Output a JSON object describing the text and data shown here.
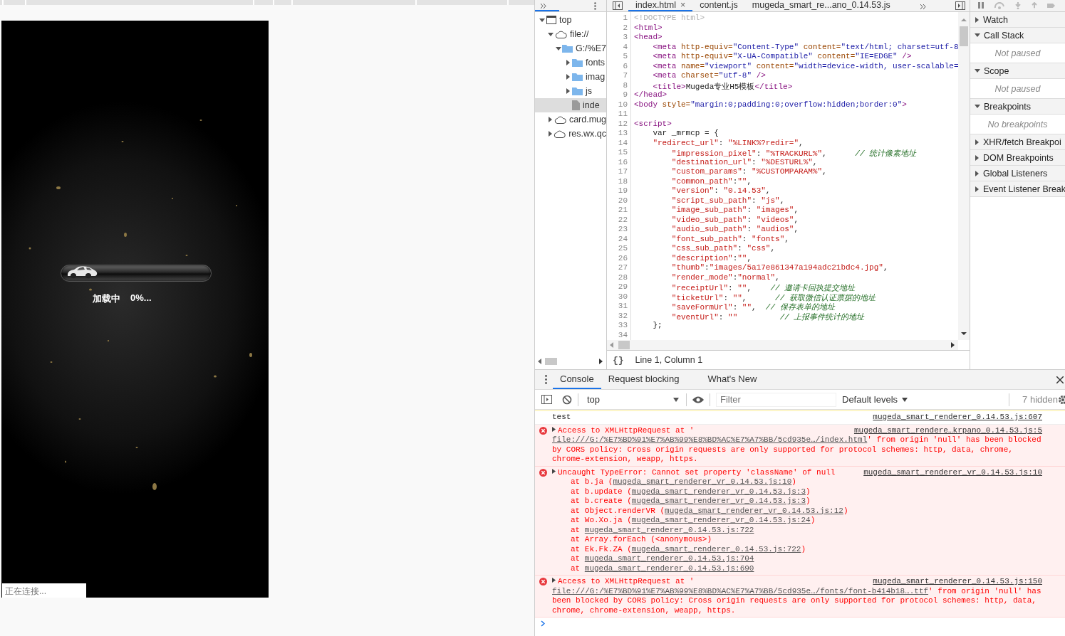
{
  "preview": {
    "progress": {
      "level": 0
    },
    "loading_label": "加载中",
    "loading_percent": "0%...",
    "status_text": "正在连接..."
  },
  "navigator": {
    "tree": [
      {
        "kind": "frame",
        "label": "top",
        "expanded": true,
        "selected": false,
        "children": [
          {
            "kind": "domain",
            "label": "file://",
            "expanded": true,
            "selected": false,
            "children": [
              {
                "kind": "folder",
                "label": "G:/%E7",
                "expanded": true,
                "selected": false,
                "children": [
                  {
                    "kind": "folder",
                    "label": "fonts",
                    "expanded": false,
                    "selected": false
                  },
                  {
                    "kind": "folder",
                    "label": "imag",
                    "expanded": false,
                    "selected": false
                  },
                  {
                    "kind": "folder",
                    "label": "js",
                    "expanded": false,
                    "selected": false
                  },
                  {
                    "kind": "file",
                    "label": "inde",
                    "selected": true
                  }
                ]
              }
            ]
          },
          {
            "kind": "domain",
            "label": "card.mug",
            "expanded": false,
            "selected": false
          },
          {
            "kind": "domain",
            "label": "res.wx.qc",
            "expanded": false,
            "selected": false
          }
        ]
      }
    ]
  },
  "editor": {
    "tabs": [
      {
        "label": "index.html",
        "selected": true,
        "close": "×"
      },
      {
        "label": "content.js",
        "selected": false
      },
      {
        "label": "mugeda_smart_re...ano_0.14.53.js",
        "selected": false
      }
    ],
    "lines": [
      {
        "number": "1",
        "tokens": [
          {
            "kind": "doctype",
            "text": "<!DOCTYPE html>"
          }
        ]
      },
      {
        "number": "2",
        "tokens": [
          {
            "kind": "tag",
            "text": "<html>"
          }
        ]
      },
      {
        "number": "3",
        "tokens": [
          {
            "kind": "tag",
            "text": "<head>"
          }
        ]
      },
      {
        "number": "4",
        "tokens": [
          {
            "kind": "tag",
            "text": "    <meta"
          },
          {
            "kind": "attr",
            "text": " http-equiv="
          },
          {
            "kind": "value",
            "text": "\"Content-Type\""
          },
          {
            "kind": "attr",
            "text": " content="
          },
          {
            "kind": "value",
            "text": "\"text/html; charset=utf-8"
          }
        ]
      },
      {
        "number": "5",
        "tokens": [
          {
            "kind": "tag",
            "text": "    <meta"
          },
          {
            "kind": "attr",
            "text": " http-equiv="
          },
          {
            "kind": "value",
            "text": "\"X-UA-Compatible\""
          },
          {
            "kind": "attr",
            "text": " content="
          },
          {
            "kind": "value",
            "text": "\"IE=EDGE\""
          },
          {
            "kind": "tag",
            "text": " />"
          }
        ]
      },
      {
        "number": "6",
        "tokens": [
          {
            "kind": "tag",
            "text": "    <meta"
          },
          {
            "kind": "attr",
            "text": " name="
          },
          {
            "kind": "value",
            "text": "\"viewport\""
          },
          {
            "kind": "attr",
            "text": " content="
          },
          {
            "kind": "value",
            "text": "\"width=device-width, user-scalable="
          }
        ]
      },
      {
        "number": "7",
        "tokens": [
          {
            "kind": "tag",
            "text": "    <meta"
          },
          {
            "kind": "attr",
            "text": " charset="
          },
          {
            "kind": "value",
            "text": "\"utf-8\""
          },
          {
            "kind": "tag",
            "text": " />"
          }
        ]
      },
      {
        "number": "8",
        "tokens": [
          {
            "kind": "tag",
            "text": "    <title>"
          },
          {
            "kind": "plain",
            "text": "Mugeda专业H5模板"
          },
          {
            "kind": "tag",
            "text": "</title>"
          }
        ]
      },
      {
        "number": "9",
        "tokens": [
          {
            "kind": "tag",
            "text": "</head>"
          }
        ]
      },
      {
        "number": "10",
        "tokens": [
          {
            "kind": "tag",
            "text": "<body"
          },
          {
            "kind": "attr",
            "text": " style="
          },
          {
            "kind": "value",
            "text": "\"margin:0;padding:0;overflow:hidden;border:0\""
          },
          {
            "kind": "tag",
            "text": ">"
          }
        ]
      },
      {
        "number": "11"
      },
      {
        "number": "12",
        "tokens": [
          {
            "kind": "tag",
            "text": "<script>"
          }
        ]
      },
      {
        "number": "13",
        "tokens": [
          {
            "kind": "plain",
            "text": "    var _mrmcp = {"
          }
        ]
      },
      {
        "number": "14",
        "tokens": [
          {
            "kind": "string",
            "text": "    \"redirect_url\""
          },
          {
            "kind": "plain",
            "text": ": "
          },
          {
            "kind": "string",
            "text": "\"%LINK%?redir=\""
          },
          {
            "kind": "plain",
            "text": ","
          }
        ]
      },
      {
        "number": "15",
        "tokens": [
          {
            "kind": "string",
            "text": "        \"impression_pixel\""
          },
          {
            "kind": "plain",
            "text": ": "
          },
          {
            "kind": "string",
            "text": "\"%TRACKURL%\""
          },
          {
            "kind": "plain",
            "text": ","
          },
          {
            "kind": "comment",
            "text": "      // 统计像素地址"
          }
        ]
      },
      {
        "number": "16",
        "tokens": [
          {
            "kind": "string",
            "text": "        \"destination_url\""
          },
          {
            "kind": "plain",
            "text": ": "
          },
          {
            "kind": "string",
            "text": "\"%DESTURL%\""
          },
          {
            "kind": "plain",
            "text": ","
          }
        ]
      },
      {
        "number": "17",
        "tokens": [
          {
            "kind": "string",
            "text": "        \"custom_params\""
          },
          {
            "kind": "plain",
            "text": ": "
          },
          {
            "kind": "string",
            "text": "\"%CUSTOMPARAM%\""
          },
          {
            "kind": "plain",
            "text": ","
          }
        ]
      },
      {
        "number": "18",
        "tokens": [
          {
            "kind": "string",
            "text": "        \"common_path\""
          },
          {
            "kind": "plain",
            "text": ":"
          },
          {
            "kind": "string",
            "text": "\"\""
          },
          {
            "kind": "plain",
            "text": ","
          }
        ]
      },
      {
        "number": "19",
        "tokens": [
          {
            "kind": "string",
            "text": "        \"version\""
          },
          {
            "kind": "plain",
            "text": ": "
          },
          {
            "kind": "string",
            "text": "\"0.14.53\""
          },
          {
            "kind": "plain",
            "text": ","
          }
        ]
      },
      {
        "number": "20",
        "tokens": [
          {
            "kind": "string",
            "text": "        \"script_sub_path\""
          },
          {
            "kind": "plain",
            "text": ": "
          },
          {
            "kind": "string",
            "text": "\"js\""
          },
          {
            "kind": "plain",
            "text": ","
          }
        ]
      },
      {
        "number": "21",
        "tokens": [
          {
            "kind": "string",
            "text": "        \"image_sub_path\""
          },
          {
            "kind": "plain",
            "text": ": "
          },
          {
            "kind": "string",
            "text": "\"images\""
          },
          {
            "kind": "plain",
            "text": ","
          }
        ]
      },
      {
        "number": "22",
        "tokens": [
          {
            "kind": "string",
            "text": "        \"video_sub_path\""
          },
          {
            "kind": "plain",
            "text": ": "
          },
          {
            "kind": "string",
            "text": "\"videos\""
          },
          {
            "kind": "plain",
            "text": ","
          }
        ]
      },
      {
        "number": "23",
        "tokens": [
          {
            "kind": "string",
            "text": "        \"audio_sub_path\""
          },
          {
            "kind": "plain",
            "text": ": "
          },
          {
            "kind": "string",
            "text": "\"audios\""
          },
          {
            "kind": "plain",
            "text": ","
          }
        ]
      },
      {
        "number": "24",
        "tokens": [
          {
            "kind": "string",
            "text": "        \"font_sub_path\""
          },
          {
            "kind": "plain",
            "text": ": "
          },
          {
            "kind": "string",
            "text": "\"fonts\""
          },
          {
            "kind": "plain",
            "text": ","
          }
        ]
      },
      {
        "number": "25",
        "tokens": [
          {
            "kind": "string",
            "text": "        \"css_sub_path\""
          },
          {
            "kind": "plain",
            "text": ": "
          },
          {
            "kind": "string",
            "text": "\"css\""
          },
          {
            "kind": "plain",
            "text": ","
          }
        ]
      },
      {
        "number": "26",
        "tokens": [
          {
            "kind": "string",
            "text": "        \"description\""
          },
          {
            "kind": "plain",
            "text": ":"
          },
          {
            "kind": "string",
            "text": "\"\""
          },
          {
            "kind": "plain",
            "text": ","
          }
        ]
      },
      {
        "number": "27",
        "tokens": [
          {
            "kind": "string",
            "text": "        \"thumb\""
          },
          {
            "kind": "plain",
            "text": ":"
          },
          {
            "kind": "string",
            "text": "\"images/5a17e861347a194adc21bdc4.jpg\""
          },
          {
            "kind": "plain",
            "text": ","
          }
        ]
      },
      {
        "number": "28",
        "tokens": [
          {
            "kind": "string",
            "text": "        \"render_mode\""
          },
          {
            "kind": "plain",
            "text": ":"
          },
          {
            "kind": "string",
            "text": "\"normal\""
          },
          {
            "kind": "plain",
            "text": ","
          }
        ]
      },
      {
        "number": "29",
        "tokens": [
          {
            "kind": "string",
            "text": "        \"receiptUrl\""
          },
          {
            "kind": "plain",
            "text": ": "
          },
          {
            "kind": "string",
            "text": "\"\""
          },
          {
            "kind": "plain",
            "text": ","
          },
          {
            "kind": "comment",
            "text": "    // 邀请卡回执提交地址"
          }
        ]
      },
      {
        "number": "30",
        "tokens": [
          {
            "kind": "string",
            "text": "        \"ticketUrl\""
          },
          {
            "kind": "plain",
            "text": ": "
          },
          {
            "kind": "string",
            "text": "\"\""
          },
          {
            "kind": "plain",
            "text": ","
          },
          {
            "kind": "comment",
            "text": "      // 获取微信认证票据的地址"
          }
        ]
      },
      {
        "number": "31",
        "tokens": [
          {
            "kind": "string",
            "text": "        \"saveFormUrl\""
          },
          {
            "kind": "plain",
            "text": ": "
          },
          {
            "kind": "string",
            "text": "\"\""
          },
          {
            "kind": "plain",
            "text": ","
          },
          {
            "kind": "comment",
            "text": "  // 保存表单的地址"
          }
        ]
      },
      {
        "number": "32",
        "tokens": [
          {
            "kind": "string",
            "text": "        \"eventUrl\""
          },
          {
            "kind": "plain",
            "text": ": "
          },
          {
            "kind": "string",
            "text": "\"\""
          },
          {
            "kind": "comment",
            "text": "         // 上报事件统计的地址"
          }
        ]
      },
      {
        "number": "33",
        "tokens": [
          {
            "kind": "plain",
            "text": "    };"
          }
        ]
      },
      {
        "number": "34"
      }
    ],
    "status": {
      "pretty_print": "{}",
      "position": "Line 1, Column 1"
    }
  },
  "sidebar": {
    "sections": [
      {
        "title": "Watch",
        "expanded": false
      },
      {
        "title": "Call Stack",
        "expanded": true,
        "note": "Not paused"
      },
      {
        "title": "Scope",
        "expanded": true,
        "note": "Not paused"
      },
      {
        "title": "Breakpoints",
        "expanded": true,
        "note": "No breakpoints"
      },
      {
        "title": "XHR/fetch Breakpoi",
        "expanded": false
      },
      {
        "title": "DOM Breakpoints",
        "expanded": false
      },
      {
        "title": "Global Listeners",
        "expanded": false
      },
      {
        "title": "Event Listener Break",
        "expanded": false
      }
    ]
  },
  "console": {
    "tabs": [
      {
        "label": "Console",
        "selected": true
      },
      {
        "label": "Request blocking",
        "selected": false
      },
      {
        "label": "What's New",
        "selected": false
      }
    ],
    "context": "top",
    "filter": {
      "placeholder": "Filter"
    },
    "levels": "Default levels",
    "hidden_count": "7 hidden",
    "messages": [
      {
        "kind": "log",
        "text": "test",
        "source": "mugeda_smart_renderer_0.14.53.js:607"
      },
      {
        "kind": "error",
        "prefix": "Access to XMLHttpRequest at '",
        "link": "file:///G:/%E7%BD%91%E7%AB%99%E8%BD%AC%E7%A7%BB/5cd935e…/index.html",
        "suffix": "' from origin 'null' has been blocked by CORS policy: Cross origin requests are only supported for protocol schemes: http, data, chrome, chrome-extension, weapp, https.",
        "source": "mugeda_smart_rendere…krpano_0.14.53.js:5"
      },
      {
        "kind": "error",
        "prefix": "Uncaught TypeError: Cannot set property 'className' of null",
        "source": "mugeda_smart_renderer_vr_0.14.53.js:10",
        "stack": [
          {
            "prefix": "at b.ja (",
            "link": "mugeda_smart_renderer_vr_0.14.53.js:10",
            "suffix": ")"
          },
          {
            "prefix": "at b.update (",
            "link": "mugeda_smart_renderer_vr_0.14.53.js:3",
            "suffix": ")"
          },
          {
            "prefix": "at b.create (",
            "link": "mugeda_smart_renderer_vr_0.14.53.js:3",
            "suffix": ")"
          },
          {
            "prefix": "at Object.renderVR (",
            "link": "mugeda_smart_renderer_vr_0.14.53.js:12",
            "suffix": ")"
          },
          {
            "prefix": "at Wo.Xo.ja (",
            "link": "mugeda_smart_renderer_vr_0.14.53.js:24",
            "suffix": ")"
          },
          {
            "prefix": "at ",
            "link": "mugeda_smart_renderer_0.14.53.js:722"
          },
          {
            "prefix": "at Array.forEach (<anonymous>)"
          },
          {
            "prefix": "at Ek.Fk.ZA (",
            "link": "mugeda_smart_renderer_0.14.53.js:722",
            "suffix": ")"
          },
          {
            "prefix": "at ",
            "link": "mugeda_smart_renderer_0.14.53.js:704"
          },
          {
            "prefix": "at ",
            "link": "mugeda_smart_renderer_0.14.53.js:690"
          }
        ]
      },
      {
        "kind": "error",
        "prefix": "Access to XMLHttpRequest at '",
        "link": "file:///G:/%E7%BD%91%E7%AB%99%E8%BD%AC%E7%A7%BB/5cd935e…/fonts/font-b414b18….ttf",
        "suffix": "' from origin 'null' has been blocked by CORS policy: Cross origin requests are only supported for protocol schemes: http, data, chrome, chrome-extension, weapp, https.",
        "source": "mugeda_smart_renderer_0.14.53.js:150"
      }
    ]
  }
}
